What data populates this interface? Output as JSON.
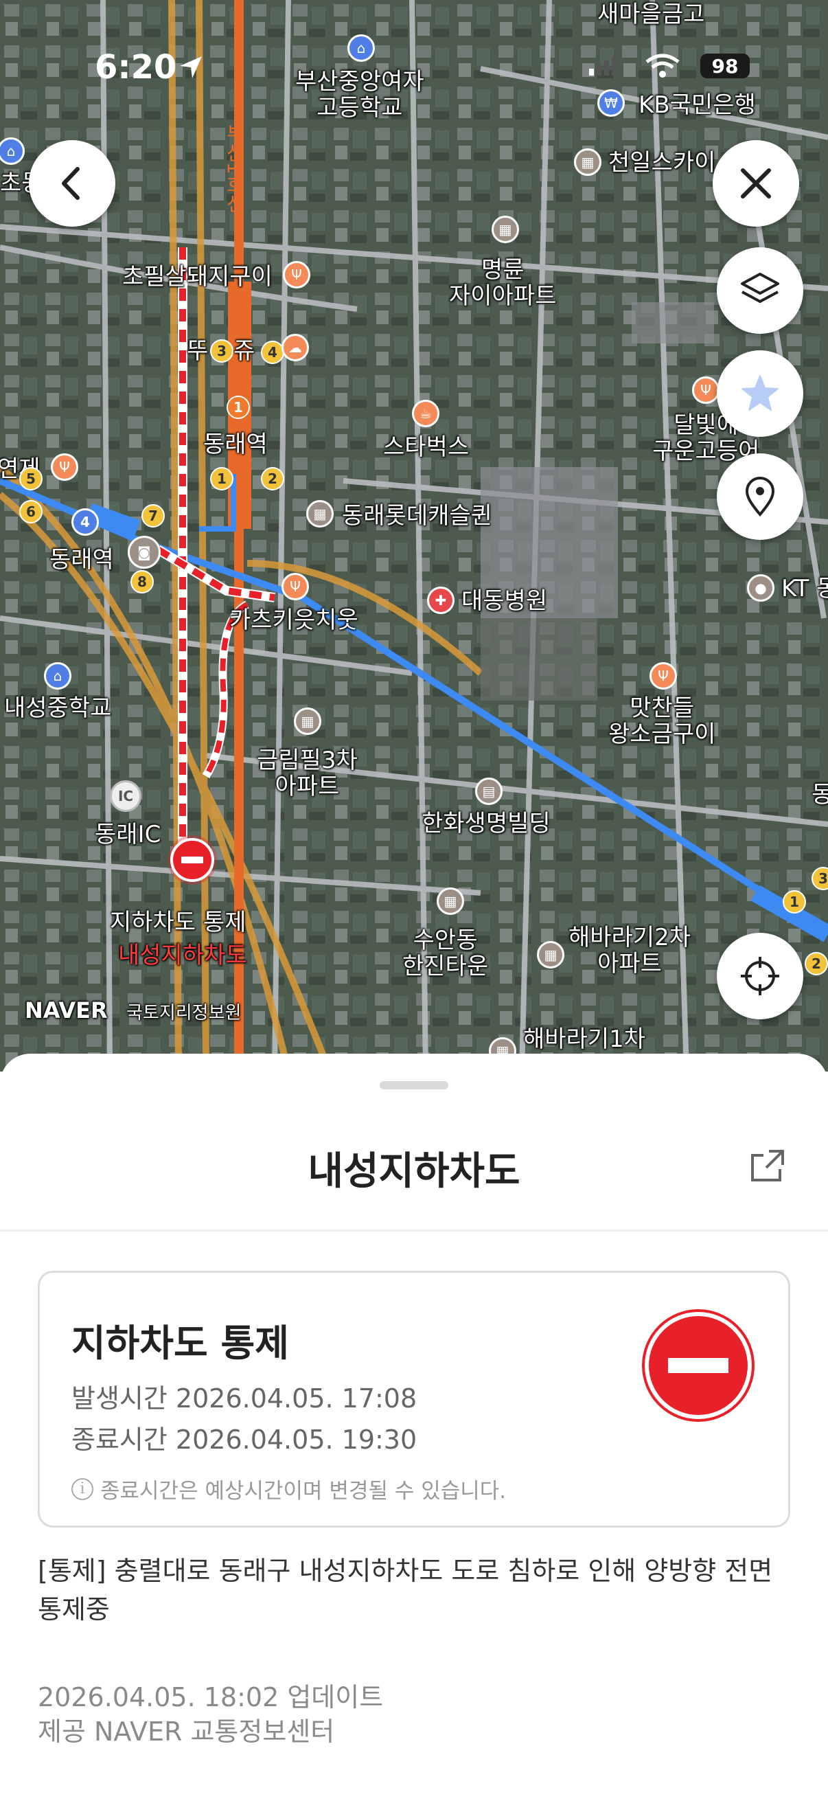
{
  "status_bar": {
    "time": "6:20",
    "battery": "98"
  },
  "map": {
    "labels": {
      "saemaeul": "새마을금고",
      "busan_girls_high": "부산중앙여자\n고등학교",
      "kb_bank": "KB국민은행",
      "cheonil_sky": "천일스카이",
      "line1": "부산1호선",
      "chopil": "초필살돼지구이",
      "myeongryun": "명륜\n자이아파트",
      "ttu_juk": "뚜",
      "ttu_juk2": "쥬",
      "dongnae_station_top": "동래역",
      "starbucks": "스타벅스",
      "dalbit": "달빛에\n구운고등어",
      "yeonje": "연제",
      "dongnae_lotte": "동래롯데캐슬퀸",
      "dongnae_station_left": "동래역",
      "kt": "KT 동",
      "katsu": "카츠키읏치웃",
      "daedong": "대동병원",
      "naeseong_middle": "내성중학교",
      "matchan": "맛찬들\n왕소금구이",
      "geumrim": "금림필3차\n아파트",
      "dongnae_ic": "동래IC",
      "hanwha": "한화생명빌딩",
      "ic_icon": "IC",
      "underpass_control": "지하차도 통제",
      "naeseong_underpass": "내성지하차도",
      "suandong": "수안동\n한진타운",
      "haebaragi2": "해바라기2차\n아파트",
      "haebaragi1": "해바라기1차",
      "naver": "NAVER",
      "ngii": "국토지리정보원",
      "cho": "초등",
      "dong_edge": "동"
    }
  },
  "sheet": {
    "title": "내성지하차도",
    "card": {
      "title": "지하차도 통제",
      "occurred": "발생시간 2026.04.05. 17:08",
      "ended": "종료시간 2026.04.05. 19:30",
      "note": "종료시간은 예상시간이며 변경될 수 있습니다."
    },
    "description": "[통제] 충렬대로 동래구 내성지하차도 도로 침하로 인해 양방향 전면 통제중",
    "updated": "2026.04.05. 18:02 업데이트",
    "provider": "제공 NAVER 교통정보센터"
  },
  "colors": {
    "route_blue": "#3d8bf2",
    "control_red": "#e8202a",
    "rail_orange": "#e86a2a"
  }
}
